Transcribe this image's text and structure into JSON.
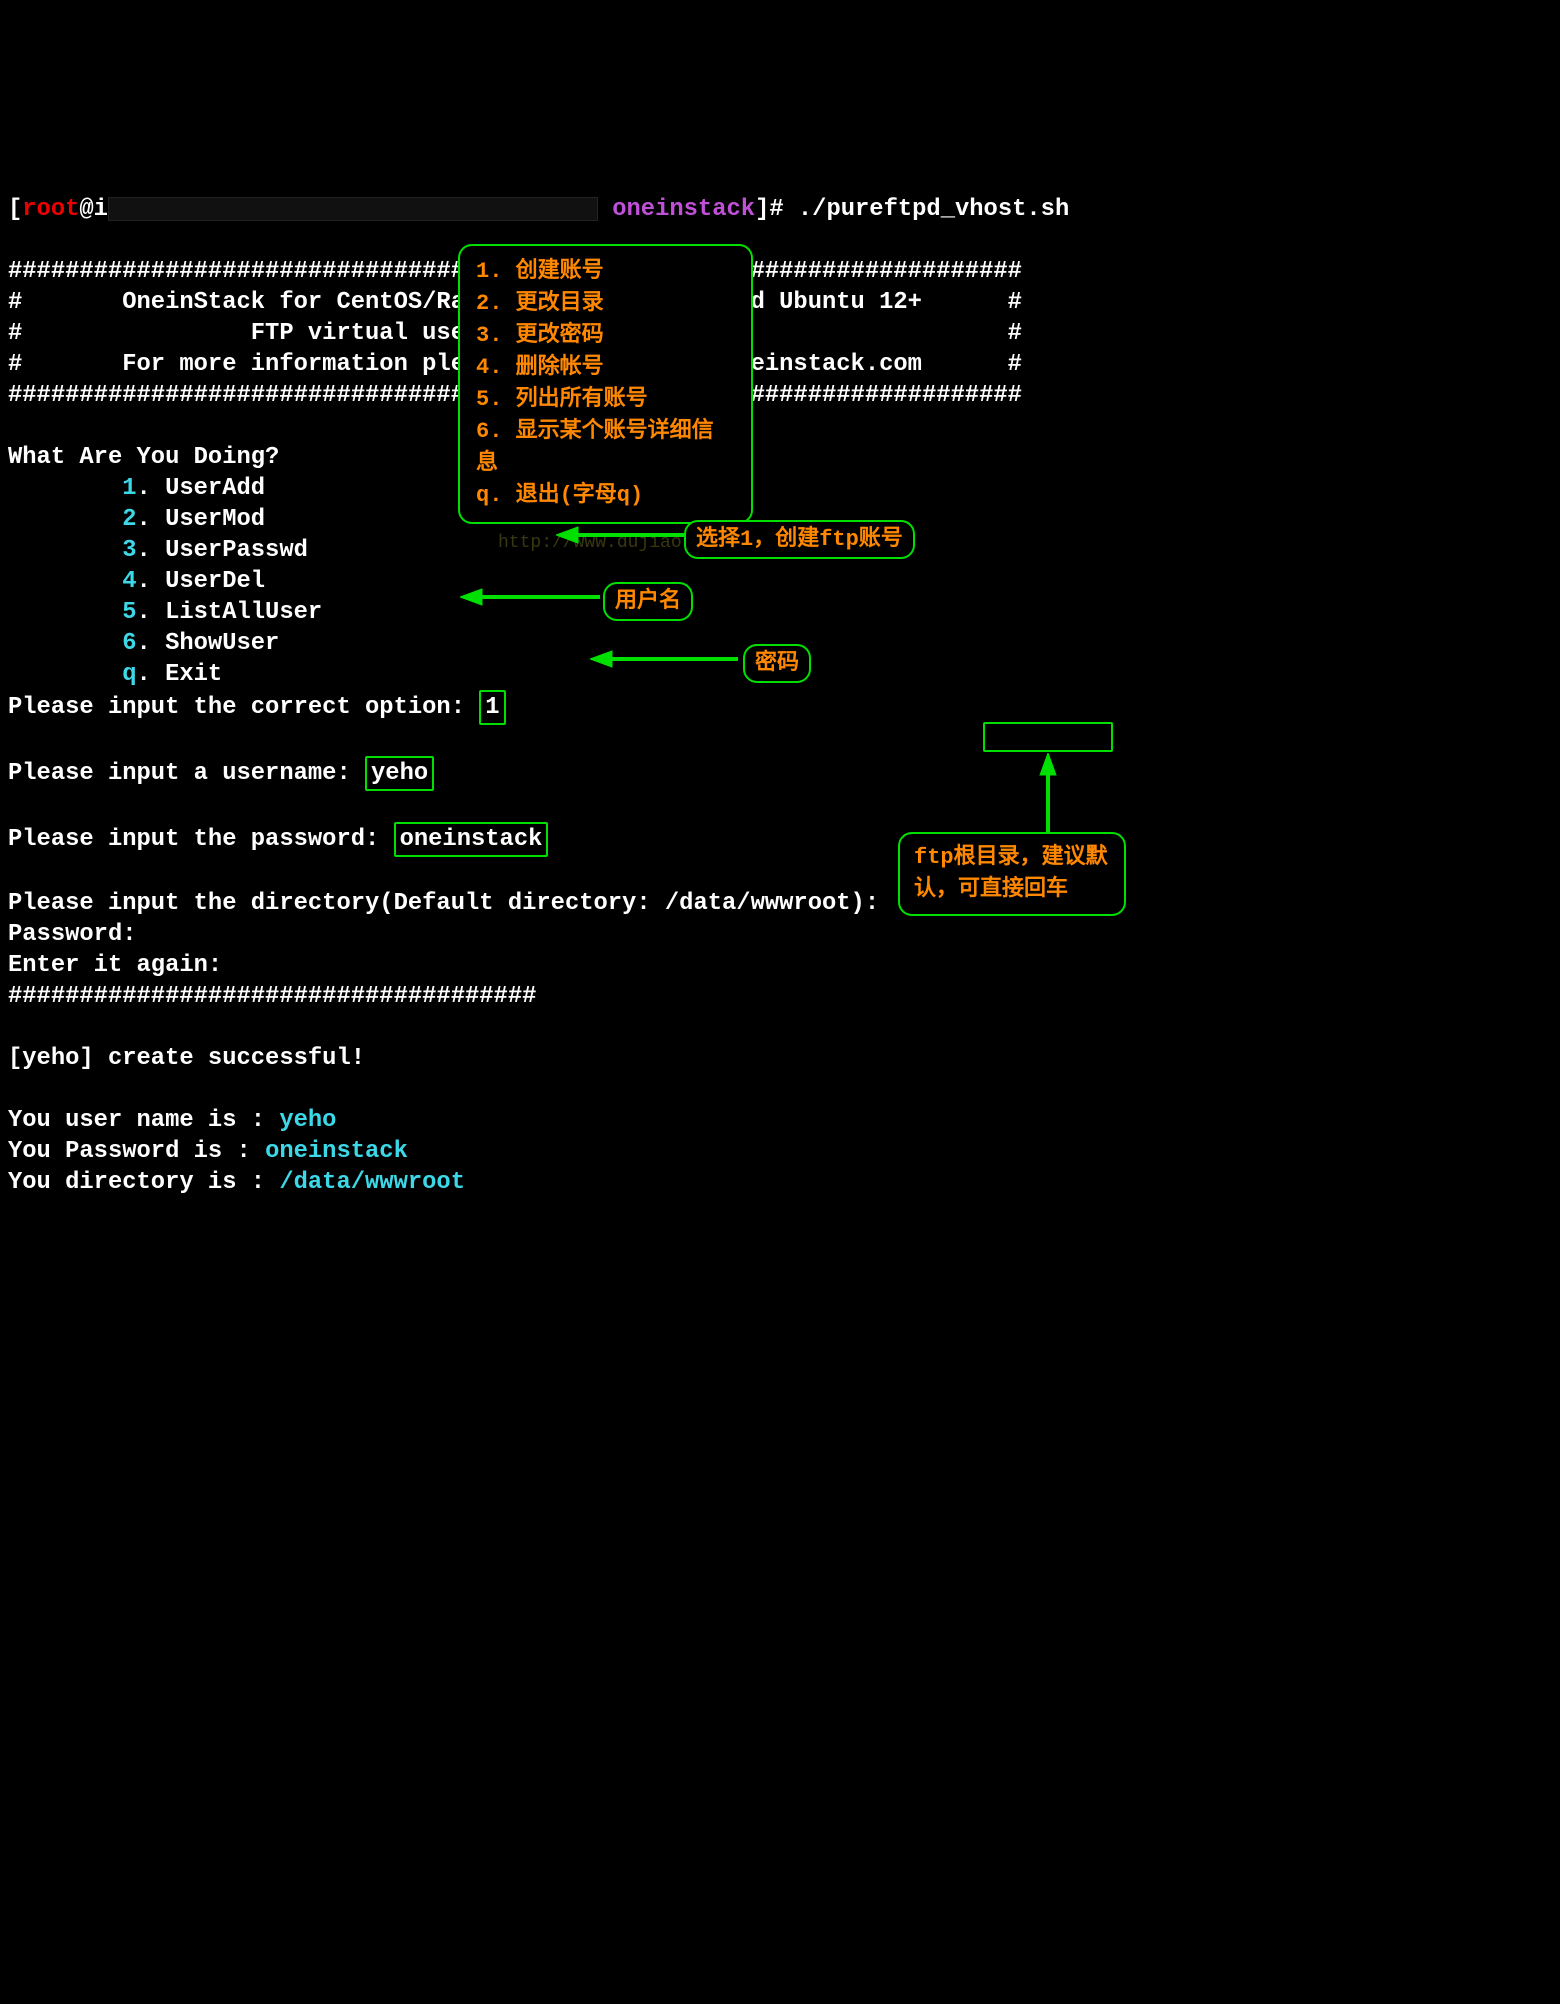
{
  "prompt": {
    "lbracket": "[",
    "user": "root",
    "at_host": "@i",
    "dir": "oneinstack",
    "rbracket": "]# ",
    "command": "./pureftpd_vhost.sh"
  },
  "banner": {
    "hashline": "#######################################################################",
    "line1": "#       OneinStack for CentOS/RadHat 5+ Debian 6+ and Ubuntu 12+      #",
    "line2": "#                FTP virtual user account management                  #",
    "line3": "#       For more information please visit https://oneinstack.com      #"
  },
  "menu": {
    "question": "What Are You Doing?",
    "items": [
      {
        "num": "1",
        "label": "UserAdd"
      },
      {
        "num": "2",
        "label": "UserMod"
      },
      {
        "num": "3",
        "label": "UserPasswd"
      },
      {
        "num": "4",
        "label": "UserDel"
      },
      {
        "num": "5",
        "label": "ListAllUser"
      },
      {
        "num": "6",
        "label": "ShowUser"
      },
      {
        "num": "q",
        "label": "Exit"
      }
    ],
    "option_prompt": "Please input the correct option: ",
    "option_value": "1"
  },
  "inputs": {
    "username_prompt": "Please input a username: ",
    "username_value": "yeho",
    "password_prompt": "Please input the password: ",
    "password_value": "oneinstack",
    "directory_prompt": "Please input the directory(Default directory: /data/wwwroot):",
    "pw_echo1": "Password:",
    "pw_echo2": "Enter it again:",
    "hashline_short": "#####################################"
  },
  "result": {
    "success": "[yeho] create successful!",
    "name_line_pre": "You user name is : ",
    "name_val": "yeho",
    "pw_line_pre": "You Password is : ",
    "pw_val": "oneinstack",
    "dir_line_pre": "You directory is : ",
    "dir_val": "/data/wwwroot"
  },
  "annot_menu": [
    "1. 创建账号",
    "2. 更改目录",
    "3. 更改密码",
    "4. 删除帐号",
    "5. 列出所有账号",
    "6. 显示某个账号详细信息",
    "q. 退出(字母q)"
  ],
  "annot_labels": {
    "option": "选择1，创建ftp账号",
    "username": "用户名",
    "password": "密码",
    "directory": "ftp根目录，建议默认，可直接回车"
  },
  "watermark": "http://www.dujiao.org"
}
